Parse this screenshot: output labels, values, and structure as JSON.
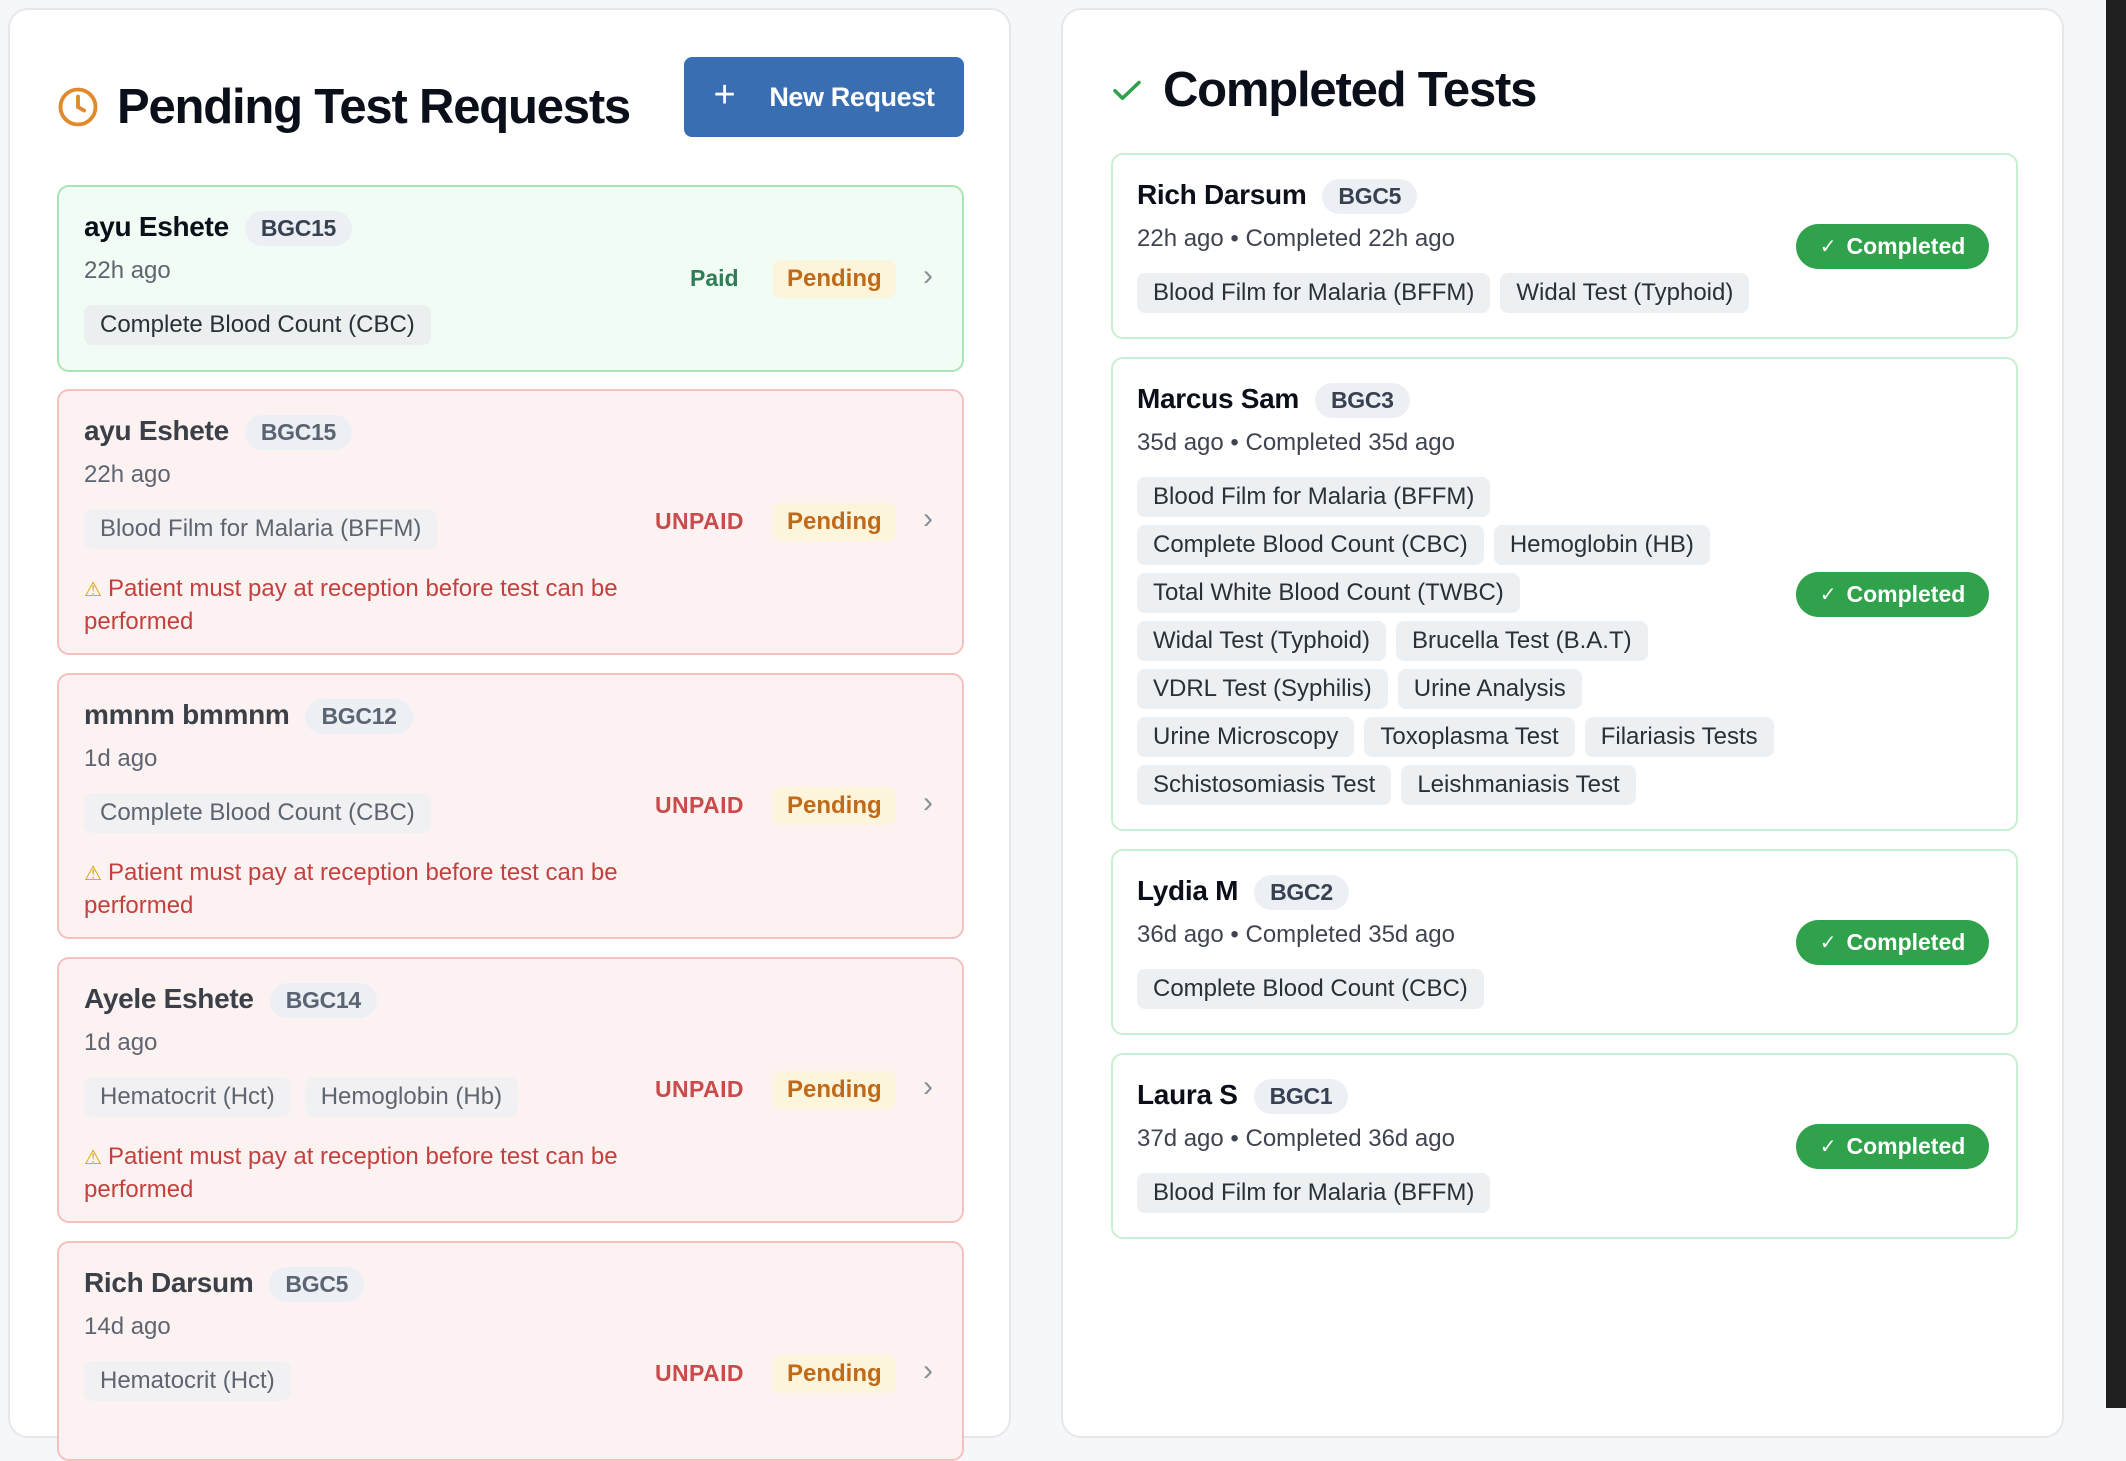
{
  "pending": {
    "title": "Pending Test Requests",
    "new_request_label": "New Request",
    "requests": [
      {
        "name": "ayu Eshete",
        "code": "BGC15",
        "time": "22h ago",
        "tests": [
          "Complete Blood Count (CBC)"
        ],
        "payment": "Paid",
        "status": "Pending",
        "warning": ""
      },
      {
        "name": "ayu Eshete",
        "code": "BGC15",
        "time": "22h ago",
        "tests": [
          "Blood Film for Malaria (BFFM)"
        ],
        "payment": "UNPAID",
        "status": "Pending",
        "warning": "Patient must pay at reception before test can be performed"
      },
      {
        "name": "mmnm bmmnm",
        "code": "BGC12",
        "time": "1d ago",
        "tests": [
          "Complete Blood Count (CBC)"
        ],
        "payment": "UNPAID",
        "status": "Pending",
        "warning": "Patient must pay at reception before test can be performed"
      },
      {
        "name": "Ayele Eshete",
        "code": "BGC14",
        "time": "1d ago",
        "tests": [
          "Hematocrit (Hct)",
          "Hemoglobin (Hb)"
        ],
        "payment": "UNPAID",
        "status": "Pending",
        "warning": "Patient must pay at reception before test can be performed"
      },
      {
        "name": "Rich Darsum",
        "code": "BGC5",
        "time": "14d ago",
        "tests": [
          "Hematocrit (Hct)"
        ],
        "payment": "UNPAID",
        "status": "Pending",
        "warning": ""
      }
    ]
  },
  "completed": {
    "title": "Completed Tests",
    "items": [
      {
        "name": "Rich Darsum",
        "code": "BGC5",
        "time": "22h ago • Completed 22h ago",
        "tests": [
          "Blood Film for Malaria (BFFM)",
          "Widal Test (Typhoid)"
        ],
        "status": "Completed"
      },
      {
        "name": "Marcus Sam",
        "code": "BGC3",
        "time": "35d ago • Completed 35d ago",
        "tests": [
          "Blood Film for Malaria (BFFM)",
          "Complete Blood Count (CBC)",
          "Hemoglobin (HB)",
          "Total White Blood Count (TWBC)",
          "Widal Test (Typhoid)",
          "Brucella Test (B.A.T)",
          "VDRL Test (Syphilis)",
          "Urine Analysis",
          "Urine Microscopy",
          "Toxoplasma Test",
          "Filariasis Tests",
          "Schistosomiasis Test",
          "Leishmaniasis Test"
        ],
        "status": "Completed"
      },
      {
        "name": "Lydia M",
        "code": "BGC2",
        "time": "36d ago • Completed 35d ago",
        "tests": [
          "Complete Blood Count (CBC)"
        ],
        "status": "Completed"
      },
      {
        "name": "Laura S",
        "code": "BGC1",
        "time": "37d ago • Completed 36d ago",
        "tests": [
          "Blood Film for Malaria (BFFM)"
        ],
        "status": "Completed"
      }
    ]
  },
  "icons": {
    "pending_header": "clock-icon",
    "completed_header": "check-icon",
    "new_request": "plus-icon",
    "row_open": "chevron-right-icon",
    "warning": "warning-icon",
    "done": "check-icon"
  },
  "colors": {
    "primary": "#3a6eb2",
    "completed": "#2fa24b",
    "unpaid": "#c94b4b",
    "paid": "#2e7d57",
    "pending": "#c06a18",
    "clock": "#e08a2b"
  }
}
